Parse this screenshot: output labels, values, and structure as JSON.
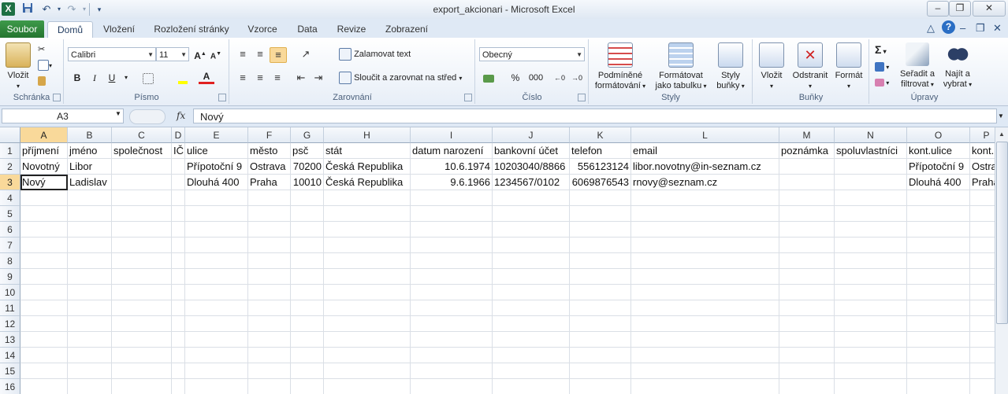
{
  "window": {
    "title": "export_akcionari  -  Microsoft Excel",
    "logo": "X",
    "icons": [
      "excel-logo-icon",
      "save-icon",
      "undo-icon",
      "redo-icon",
      "customize-qat-icon"
    ]
  },
  "tabs": {
    "file": "Soubor",
    "items": [
      "Domů",
      "Vložení",
      "Rozložení stránky",
      "Vzorce",
      "Data",
      "Revize",
      "Zobrazení"
    ],
    "active": "Domů"
  },
  "ribbon": {
    "clipboard": {
      "label": "Schránka",
      "paste": "Vložit"
    },
    "font": {
      "label": "Písmo",
      "name": "Calibri",
      "size": "11",
      "bold": "B",
      "italic": "I",
      "underline": "U"
    },
    "alignment": {
      "label": "Zarovnání",
      "wrap": "Zalamovat text",
      "merge": "Sloučit a zarovnat na střed"
    },
    "number": {
      "label": "Číslo",
      "format": "Obecný",
      "percent": "%",
      "thousands": "000"
    },
    "styles": {
      "label": "Styly",
      "conditional": [
        "Podmíněné",
        "formátování"
      ],
      "as_table": [
        "Formátovat",
        "jako tabulku"
      ],
      "cell_styles": [
        "Styly",
        "buňky"
      ]
    },
    "cells": {
      "label": "Buňky",
      "insert": "Vložit",
      "delete": "Odstranit",
      "format": "Formát"
    },
    "editing": {
      "label": "Úpravy",
      "sort": [
        "Seřadit a",
        "filtrovat"
      ],
      "find": [
        "Najít a",
        "vybrat"
      ],
      "sum": "Σ"
    }
  },
  "formula_bar": {
    "name_box": "A3",
    "fx": "fx",
    "content": "Nový"
  },
  "columns": [
    "A",
    "B",
    "C",
    "D",
    "E",
    "F",
    "G",
    "H",
    "I",
    "J",
    "K",
    "L",
    "M",
    "N",
    "O",
    "P"
  ],
  "rows": [
    "1",
    "2",
    "3",
    "4",
    "5",
    "6",
    "7",
    "8",
    "9",
    "10",
    "11",
    "12",
    "13",
    "14",
    "15",
    "16"
  ],
  "cells": {
    "r1": [
      "příjmení",
      "jméno",
      "společnost",
      "IČ",
      "ulice",
      "město",
      "psč",
      "stát",
      "datum narození",
      "bankovní účet",
      "telefon",
      "email",
      "poznámka",
      "spoluvlastníci",
      "kont.ulice",
      "kont.m"
    ],
    "r2": [
      "Novotný",
      "Libor",
      "",
      "",
      "Přípotoční 9",
      "Ostrava",
      "70200",
      "Česká Republika",
      "10.6.1974",
      "10203040/8866",
      "556123124",
      "libor.novotny@in-seznam.cz",
      "",
      "",
      "Přípotoční 9",
      "Ostra"
    ],
    "r3": [
      "Nový",
      "Ladislav",
      "",
      "",
      "Dlouhá 400",
      "Praha",
      "10010",
      "Česká Republika",
      "9.6.1966",
      "1234567/0102",
      "6069876543",
      "rnovy@seznam.cz",
      "",
      "",
      "Dlouhá 400",
      "Praha"
    ]
  },
  "active_cell": "A3"
}
